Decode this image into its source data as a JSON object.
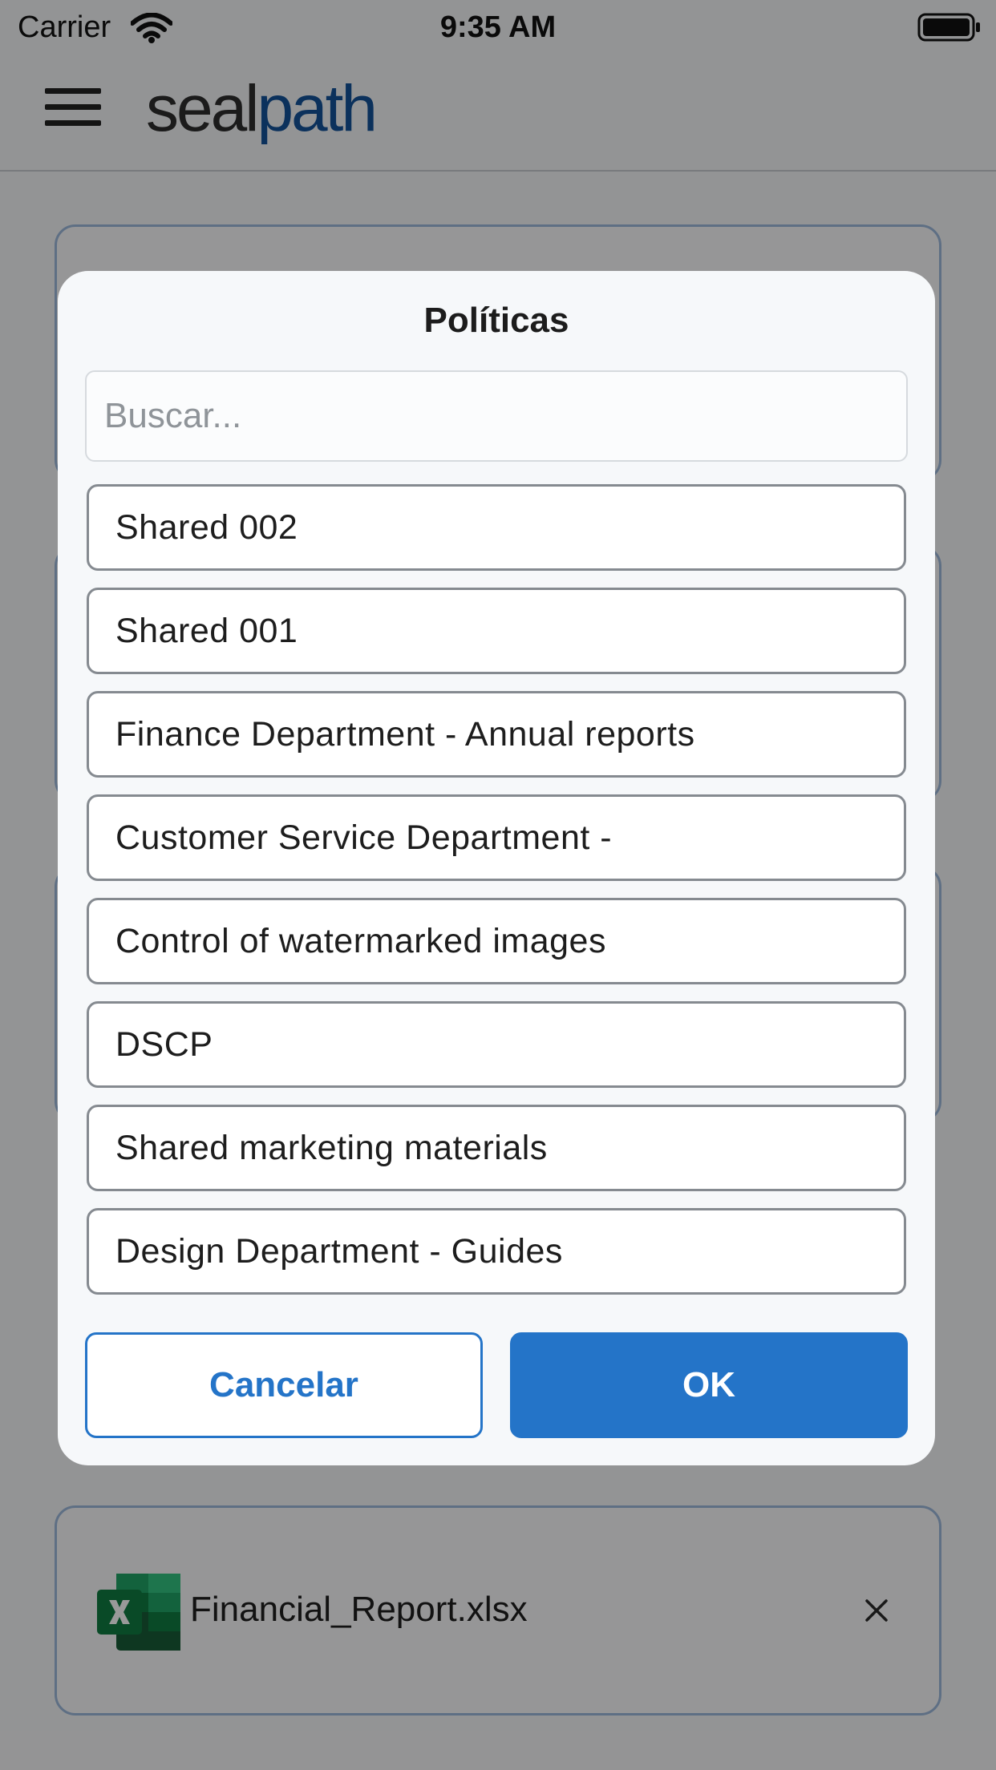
{
  "status_bar": {
    "carrier": "Carrier",
    "time": "9:35 AM"
  },
  "header": {
    "brand_part1": "seal",
    "brand_part2": "path",
    "icons": {
      "menu": "hamburger-menu-icon"
    }
  },
  "file_card": {
    "file_name": "Financial_Report.xlsx",
    "file_icon": "excel-file-icon",
    "remove_icon": "close-icon"
  },
  "dialog": {
    "title": "Políticas",
    "search_placeholder": "Buscar...",
    "policies": [
      "Shared 002",
      "Shared 001",
      "Finance Department - Annual reports",
      "Customer Service Department -",
      "Control of watermarked images",
      "DSCP",
      "Shared marketing materials",
      "Design Department - Guides"
    ],
    "cancel_label": "Cancelar",
    "ok_label": "OK"
  },
  "colors": {
    "accent": "#2474c8",
    "brand_blue": "#13529a",
    "excel_green": "#1d6f42",
    "card_border": "#9db9dd"
  }
}
